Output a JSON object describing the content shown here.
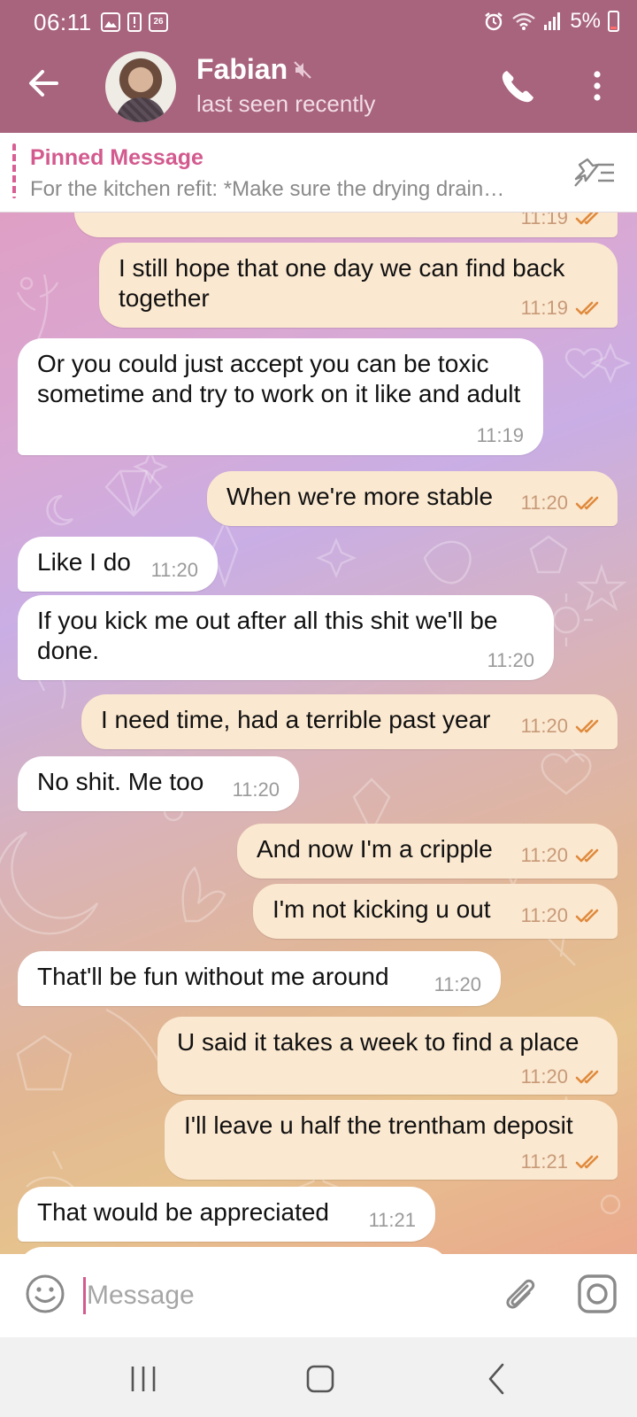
{
  "status_bar": {
    "time": "06:11",
    "calendar_day": "26",
    "battery": "5%"
  },
  "header": {
    "contact_name": "Fabian",
    "last_seen": "last seen recently",
    "muted": true
  },
  "pinned": {
    "title": "Pinned Message",
    "text": "For the kitchen refit: *Make sure the drying drain…"
  },
  "messages": [
    {
      "dir": "out",
      "text": "",
      "time": "11:19",
      "read": true
    },
    {
      "dir": "out",
      "text": "I still hope that one day we can find back together",
      "time": "11:19",
      "read": true
    },
    {
      "dir": "in",
      "text": "Or you could just accept you can be toxic sometime and try to work on it like and adult",
      "time": "11:19"
    },
    {
      "dir": "out",
      "text": "When we're more stable",
      "time": "11:20",
      "read": true
    },
    {
      "dir": "in",
      "text": "Like I do",
      "time": "11:20"
    },
    {
      "dir": "in",
      "text": "If you kick me out after all this shit we'll be done.",
      "time": "11:20"
    },
    {
      "dir": "out",
      "text": "I need time, had a terrible past year",
      "time": "11:20",
      "read": true
    },
    {
      "dir": "in",
      "text": "No shit. Me too",
      "time": "11:20"
    },
    {
      "dir": "out",
      "text": "And now I'm a cripple",
      "time": "11:20",
      "read": true
    },
    {
      "dir": "out",
      "text": "I'm not kicking u out",
      "time": "11:20",
      "read": true
    },
    {
      "dir": "in",
      "text": "That'll be fun without me around",
      "time": "11:20"
    },
    {
      "dir": "out",
      "text": "U said it takes a week to find a place",
      "time": "11:20",
      "read": true
    },
    {
      "dir": "out",
      "text": "I'll leave u half the trentham deposit",
      "time": "11:21",
      "read": true
    },
    {
      "dir": "in",
      "text": "That would be appreciated",
      "time": "11:21"
    }
  ],
  "input": {
    "placeholder": "Message",
    "value": ""
  },
  "colors": {
    "header": "#a8637d",
    "accent": "#d35a8e",
    "outgoing_bubble": "#fbe8d0",
    "incoming_bubble": "#ffffff",
    "read_ticks": "#e08a3c"
  },
  "icons": {
    "back": "arrow-left-icon",
    "mute": "speaker-muted-icon",
    "call": "phone-icon",
    "more": "more-vertical-icon",
    "unpin": "unpin-icon",
    "emoji": "smiley-icon",
    "attach": "paperclip-icon",
    "camera": "camera-icon"
  }
}
